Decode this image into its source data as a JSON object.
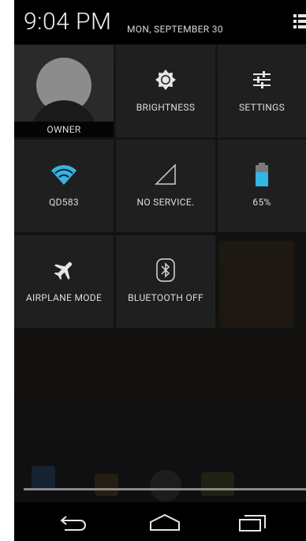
{
  "status_bar": {
    "time": "9:04 PM",
    "date": "MON, SEPTEMBER 30"
  },
  "quick_settings": {
    "owner": {
      "label": "OWNER"
    },
    "brightness": {
      "label": "BRIGHTNESS"
    },
    "settings": {
      "label": "SETTINGS"
    },
    "wifi": {
      "label": "QD583"
    },
    "signal": {
      "label": "NO SERVICE."
    },
    "battery": {
      "label": "65%",
      "level": 0.65
    },
    "airplane": {
      "label": "AIRPLANE MODE"
    },
    "bluetooth": {
      "label": "BLUETOOTH OFF"
    }
  },
  "colors": {
    "wifi_accent": "#33b5e5",
    "battery_accent": "#33b5e5"
  },
  "icons": {
    "header": "notifications-list-icon",
    "brightness": "brightness-icon",
    "settings": "settings-sliders-icon",
    "wifi": "wifi-icon",
    "signal": "cell-signal-icon",
    "battery": "battery-icon",
    "airplane": "airplane-icon",
    "bluetooth": "bluetooth-icon",
    "nav_back": "back-icon",
    "nav_home": "home-icon",
    "nav_recent": "recent-apps-icon"
  }
}
